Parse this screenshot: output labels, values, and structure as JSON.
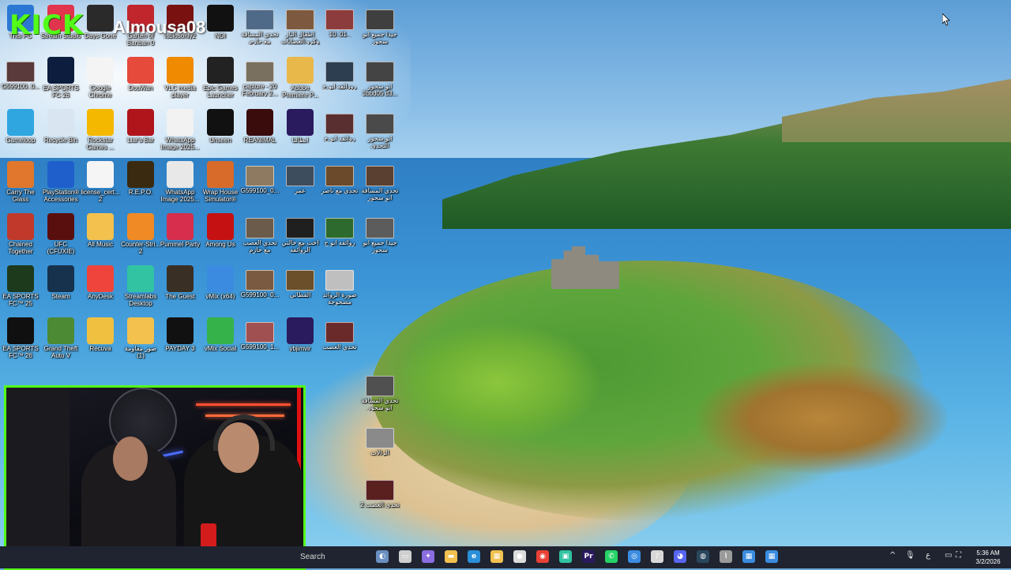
{
  "overlay": {
    "brand": "KICK",
    "username": "Almousa08"
  },
  "desktop": {
    "icons": [
      {
        "label": "This PC",
        "icon": "this-pc-icon",
        "color": "#2b78d4"
      },
      {
        "label": "Stream Studio",
        "icon": "stream-studio-icon",
        "color": "#e0354d"
      },
      {
        "label": "Days Gone",
        "icon": "days-gone-icon",
        "color": "#2a2a2a"
      },
      {
        "label": "Garten of Banban 0",
        "icon": "garten-of-banban-icon",
        "color": "#c0262c"
      },
      {
        "label": "Isblosonly2",
        "icon": "app-icon",
        "color": "#7a1111"
      },
      {
        "label": "NDI",
        "icon": "ndi-icon",
        "color": "#111111"
      },
      {
        "label": "تحدي المسافة مع حازم",
        "icon": "video-thumbnail-icon",
        "color": "#4f6a88"
      },
      {
        "label": "اطفال النار وكرو العصابات",
        "icon": "video-thumbnail-icon",
        "color": "#7d5a3f"
      },
      {
        "label": "10_01_",
        "icon": "video-thumbnail-icon",
        "color": "#8c3c3c"
      },
      {
        "label": "جيدا جميع ابو سحور",
        "icon": "video-thumbnail-icon",
        "color": "#3f3f3f"
      },
      {
        "label": "G599100_0...",
        "icon": "video-thumbnail-icon",
        "color": "#5a3a3a"
      },
      {
        "label": "EA SPORTS FC 26",
        "icon": "ea-fc-icon",
        "color": "#0c1d3d"
      },
      {
        "label": "Google Chrome",
        "icon": "chrome-icon",
        "color": "#f4f4f4"
      },
      {
        "label": "DouWan",
        "icon": "douwan-icon",
        "color": "#e64a3b"
      },
      {
        "label": "VLC media player",
        "icon": "vlc-icon",
        "color": "#f08a00"
      },
      {
        "label": "Epic Games Launcher",
        "icon": "epic-games-icon",
        "color": "#222222"
      },
      {
        "label": "capture - 20 February 2...",
        "icon": "video-thumbnail-icon",
        "color": "#7a7060"
      },
      {
        "label": "Adobe Premiere P...",
        "icon": "folder-icon",
        "color": "#e9b84a"
      },
      {
        "label": "روزائفه ابو ج",
        "icon": "video-thumbnail-icon",
        "color": "#2c3e50"
      },
      {
        "label": "ابو سحور 3bbd05 d3...",
        "icon": "video-thumbnail-icon",
        "color": "#444444"
      },
      {
        "label": "Gameloop",
        "icon": "gameloop-icon",
        "color": "#2fa6e0"
      },
      {
        "label": "Recycle Bin",
        "icon": "recycle-bin-icon",
        "color": "#d9e6f2"
      },
      {
        "label": "Rockstar Games ...",
        "icon": "rockstar-icon",
        "color": "#f5b800"
      },
      {
        "label": "Liar's Bar",
        "icon": "liars-bar-icon",
        "color": "#b0151b"
      },
      {
        "label": "WhatsApp Image 2025...",
        "icon": "image-file-icon",
        "color": "#f2f2f2"
      },
      {
        "label": "Unseen",
        "icon": "unseen-icon",
        "color": "#111111"
      },
      {
        "label": "REANIMAL",
        "icon": "reanimal-icon",
        "color": "#3a0c0c"
      },
      {
        "label": "ابطالنا",
        "icon": "premiere-project-icon",
        "color": "#2a1a5e"
      },
      {
        "label": "روائفه ابو ج",
        "icon": "video-thumbnail-icon",
        "color": "#5a2f2f"
      },
      {
        "label": "ابو سحور التحدي",
        "icon": "video-thumbnail-icon",
        "color": "#4a4a4a"
      },
      {
        "label": "Carry The Glass",
        "icon": "carry-glass-icon",
        "color": "#e0772c"
      },
      {
        "label": "PlayStation® Accessories",
        "icon": "playstation-icon",
        "color": "#1f5fcc"
      },
      {
        "label": "license_cert... 2",
        "icon": "text-file-icon",
        "color": "#f5f5f5"
      },
      {
        "label": "R.E.P.O.",
        "icon": "repo-icon",
        "color": "#3a2a10"
      },
      {
        "label": "WhatsApp Image 2025...",
        "icon": "image-file-icon",
        "color": "#e8e8e8"
      },
      {
        "label": "Wrap House Simulator®",
        "icon": "wrap-house-icon",
        "color": "#d86b2a"
      },
      {
        "label": "G599100_0...",
        "icon": "video-thumbnail-icon",
        "color": "#8d7a60"
      },
      {
        "label": "عمر",
        "icon": "video-thumbnail-icon",
        "color": "#3d4d5d"
      },
      {
        "label": "تحدي مع ناصر",
        "icon": "video-thumbnail-icon",
        "color": "#6a4a2a"
      },
      {
        "label": "تحدي المسافة ابو سحور",
        "icon": "video-thumbnail-icon",
        "color": "#5a4030"
      },
      {
        "label": "Chained Together",
        "icon": "chained-together-icon",
        "color": "#c0392b"
      },
      {
        "label": "UFC (CFUXIE)",
        "icon": "ufc-icon",
        "color": "#5a0f0f"
      },
      {
        "label": "All Music",
        "icon": "folder-icon",
        "color": "#f2c14e"
      },
      {
        "label": "Counter-Stri... 2",
        "icon": "counter-strike-icon",
        "color": "#f08a24"
      },
      {
        "label": "Pummel Party",
        "icon": "pummel-party-icon",
        "color": "#d62e4c"
      },
      {
        "label": "Among Us",
        "icon": "among-us-icon",
        "color": "#c51111"
      },
      {
        "label": "تحدي العصب مع حازم",
        "icon": "video-thumbnail-icon",
        "color": "#6b5b4b"
      },
      {
        "label": "اخت مع خالتي الروائفه",
        "icon": "video-thumbnail-icon",
        "color": "#1f1f1f"
      },
      {
        "label": "روائفه ابو ج",
        "icon": "video-thumbnail-icon",
        "color": "#2d6a2d"
      },
      {
        "label": "جيدا جميع ابو سحور",
        "icon": "video-thumbnail-icon",
        "color": "#5c5c5c"
      },
      {
        "label": "EA SPORTS FC™ 25",
        "icon": "ea-fc-icon",
        "color": "#1d3a1d"
      },
      {
        "label": "Steam",
        "icon": "steam-icon",
        "color": "#17324d"
      },
      {
        "label": "AnyDesk",
        "icon": "anydesk-icon",
        "color": "#ef443b"
      },
      {
        "label": "Streamlabs Desktop",
        "icon": "streamlabs-icon",
        "color": "#31c3a2"
      },
      {
        "label": "The Guest",
        "icon": "the-guest-icon",
        "color": "#3a2f25"
      },
      {
        "label": "vMix (x64)",
        "icon": "vmix-icon",
        "color": "#3b8ce0"
      },
      {
        "label": "G599100_0...",
        "icon": "video-thumbnail-icon",
        "color": "#7a5a40"
      },
      {
        "label": "القطاني",
        "icon": "video-thumbnail-icon",
        "color": "#6a4f2a"
      },
      {
        "label": "صورة الروائد مضحوجة",
        "icon": "video-thumbnail-icon",
        "color": "#bfbfbf"
      },
      {
        "label": "EA SPORTS FC™ 26",
        "icon": "ea-fc-icon",
        "color": "#101010"
      },
      {
        "label": "Grand Theft Auto V",
        "icon": "gta-v-icon",
        "color": "#4d8a34"
      },
      {
        "label": "Recuva",
        "icon": "recuva-icon",
        "color": "#f0c040"
      },
      {
        "label": "صور مقاومة (1)",
        "icon": "folder-icon",
        "color": "#f2c14e"
      },
      {
        "label": "PAYDAY 3",
        "icon": "payday-icon",
        "color": "#111111"
      },
      {
        "label": "vMix Social",
        "icon": "vmix-social-icon",
        "color": "#36b24a"
      },
      {
        "label": "G599100_1...",
        "icon": "video-thumbnail-icon",
        "color": "#a05050"
      },
      {
        "label": "ybjimvir",
        "icon": "premiere-project-icon",
        "color": "#2a1a5e"
      },
      {
        "label": "تحدي العصب",
        "icon": "video-thumbnail-icon",
        "color": "#6a2a2a"
      },
      {
        "label": "تحدي المسافة ابو سحور",
        "icon": "video-thumbnail-icon",
        "color": "#505050"
      },
      {
        "label": "الرالات",
        "icon": "video-thumbnail-icon",
        "color": "#8a8a8a"
      },
      {
        "label": "تحدي العصب 2",
        "icon": "video-thumbnail-icon",
        "color": "#5a2020"
      }
    ]
  },
  "taskbar": {
    "search_text": "Search",
    "apps": [
      {
        "name": "widgets",
        "icon": "widgets-icon",
        "glyph": "◐",
        "color": "#6a8fc0"
      },
      {
        "name": "task-view",
        "icon": "task-view-icon",
        "glyph": "▭",
        "color": "#cfcfcf"
      },
      {
        "name": "copilot",
        "icon": "copilot-icon",
        "glyph": "✦",
        "color": "#8a6de0"
      },
      {
        "name": "file-explorer",
        "icon": "folder-icon",
        "glyph": "▬",
        "color": "#f2c14e"
      },
      {
        "name": "edge",
        "icon": "edge-icon",
        "glyph": "e",
        "color": "#2a8fd8"
      },
      {
        "name": "store",
        "icon": "store-icon",
        "glyph": "▦",
        "color": "#f2c14e"
      },
      {
        "name": "maps",
        "icon": "location-icon",
        "glyph": "●",
        "color": "#dcdcdc"
      },
      {
        "name": "chrome",
        "icon": "chrome-icon",
        "glyph": "◉",
        "color": "#e84035"
      },
      {
        "name": "streamlabs",
        "icon": "streamlabs-icon",
        "glyph": "▣",
        "color": "#31c3a2"
      },
      {
        "name": "premiere",
        "icon": "premiere-icon",
        "glyph": "Pr",
        "color": "#2a1a5e"
      },
      {
        "name": "whatsapp",
        "icon": "whatsapp-icon",
        "glyph": "✆",
        "color": "#25d366"
      },
      {
        "name": "browser",
        "icon": "browser-icon",
        "glyph": "◎",
        "color": "#3b8ce0"
      },
      {
        "name": "music",
        "icon": "music-icon",
        "glyph": "♪",
        "color": "#d8d8d8"
      },
      {
        "name": "discord",
        "icon": "discord-icon",
        "glyph": "◕",
        "color": "#5865f2"
      },
      {
        "name": "steam",
        "icon": "steam-icon",
        "glyph": "◍",
        "color": "#2a475e"
      },
      {
        "name": "epic",
        "icon": "epic-games-icon",
        "glyph": "⌇",
        "color": "#9a9a9a"
      },
      {
        "name": "vmix",
        "icon": "vmix-icon",
        "glyph": "▦",
        "color": "#3b8ce0"
      },
      {
        "name": "vmix-2",
        "icon": "vmix-icon",
        "glyph": "▦",
        "color": "#3b8ce0"
      }
    ],
    "tray": {
      "chevron": "^",
      "mic": "🎙",
      "lang": "ع",
      "display": "▭",
      "network": "⛶",
      "volume": "🔊",
      "time": "5:36 AM",
      "date": "3/2/2026"
    }
  }
}
